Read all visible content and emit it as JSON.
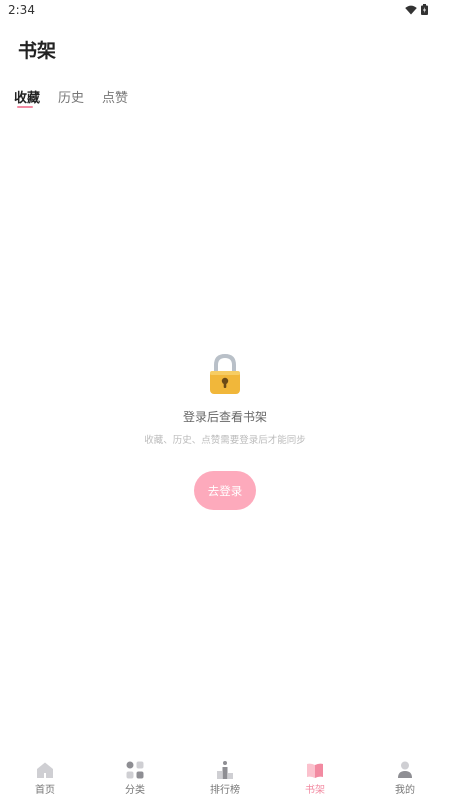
{
  "status_bar": {
    "time": "2:34"
  },
  "page": {
    "title": "书架"
  },
  "tabs": [
    {
      "label": "收藏",
      "active": true
    },
    {
      "label": "历史",
      "active": false
    },
    {
      "label": "点赞",
      "active": false
    }
  ],
  "empty_state": {
    "icon": "lock-icon",
    "title": "登录后查看书架",
    "subtitle": "收藏、历史、点赞需要登录后才能同步",
    "button_label": "去登录"
  },
  "bottom_nav": [
    {
      "label": "首页",
      "icon": "home-icon",
      "active": false
    },
    {
      "label": "分类",
      "icon": "category-icon",
      "active": false
    },
    {
      "label": "排行榜",
      "icon": "ranking-icon",
      "active": false
    },
    {
      "label": "书架",
      "icon": "bookshelf-icon",
      "active": true
    },
    {
      "label": "我的",
      "icon": "profile-icon",
      "active": false
    }
  ],
  "colors": {
    "accent": "#f28aa1",
    "button_bg": "#fdaabc"
  }
}
